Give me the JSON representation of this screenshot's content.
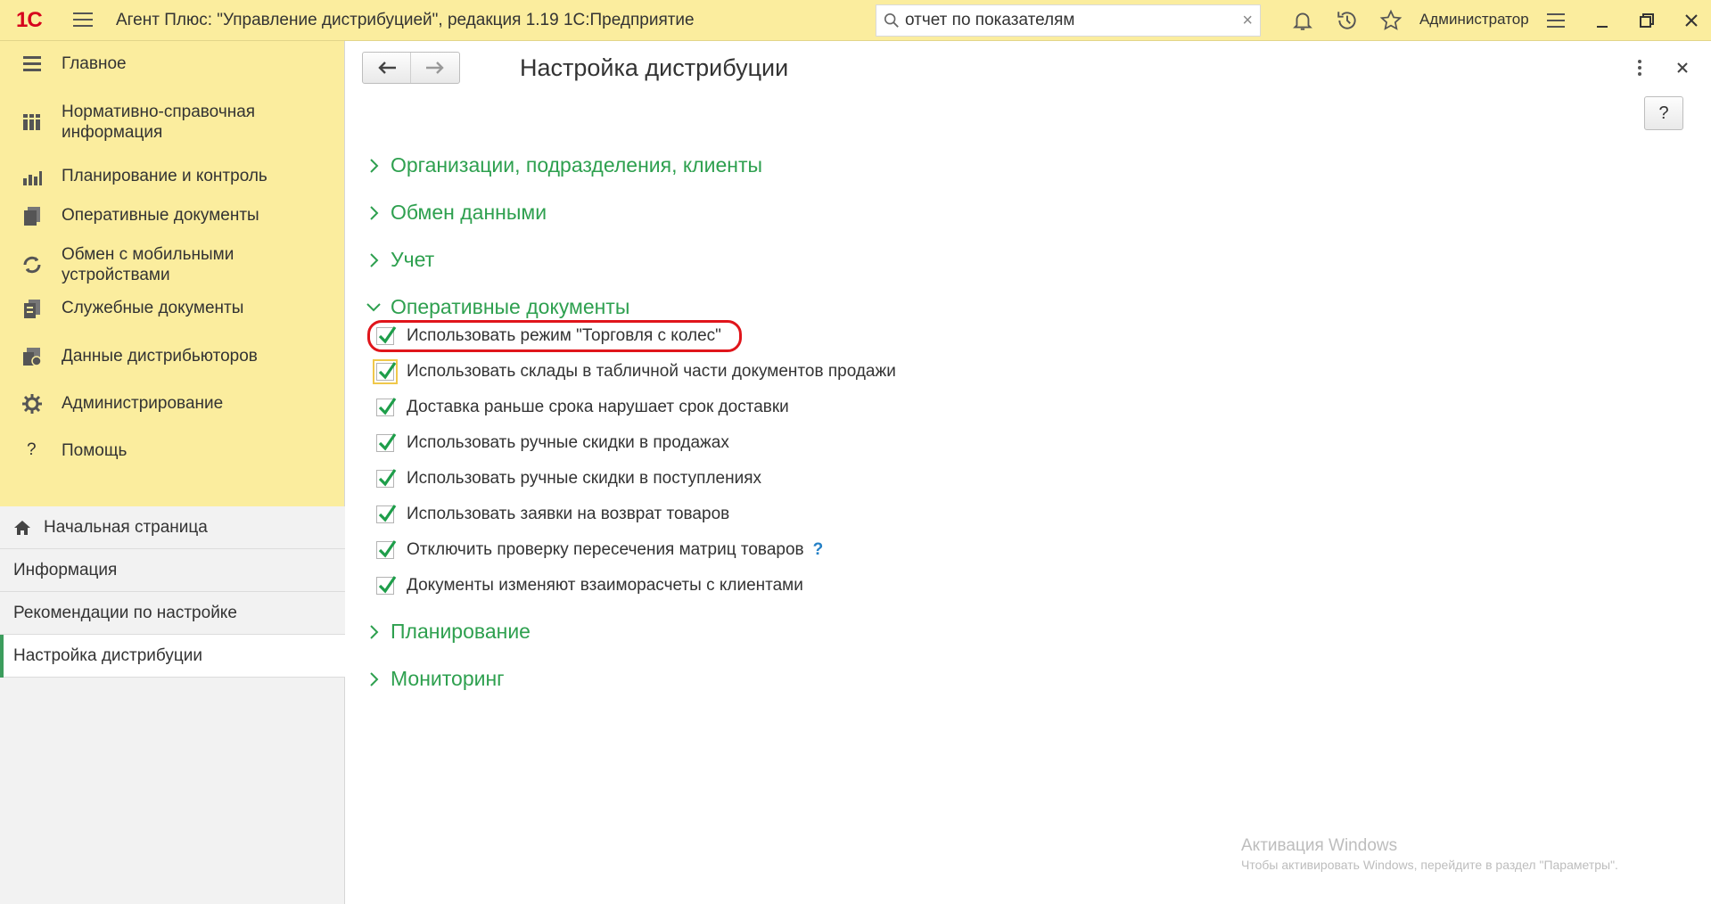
{
  "titlebar": {
    "logo": "1С",
    "app_title": "Агент Плюс: \"Управление дистрибуцией\", редакция 1.19 1С:Предприятие",
    "search": {
      "value": "отчет по показателям",
      "clear_glyph": "×"
    },
    "user": "Администратор"
  },
  "sidebar": {
    "sections": [
      {
        "label": "Главное",
        "icon": "menu-icon"
      },
      {
        "label": "Нормативно-справочная информация",
        "icon": "books-icon"
      },
      {
        "label": "Планирование и контроль",
        "icon": "chart-icon"
      },
      {
        "label": "Оперативные документы",
        "icon": "documents-icon"
      },
      {
        "label": "Обмен с мобильными устройствами",
        "icon": "sync-icon"
      },
      {
        "label": "Служебные документы",
        "icon": "service-docs-icon"
      },
      {
        "label": "Данные дистрибьюторов",
        "icon": "distributor-data-icon"
      },
      {
        "label": "Администрирование",
        "icon": "gear-icon"
      },
      {
        "label": "Помощь",
        "icon": "help-icon"
      }
    ],
    "open_windows": [
      {
        "label": "Начальная страница",
        "icon": "home-icon"
      },
      {
        "label": "Информация"
      },
      {
        "label": "Рекомендации по настройке"
      },
      {
        "label": "Настройка дистрибуции",
        "active": true
      }
    ]
  },
  "content": {
    "title": "Настройка дистрибуции",
    "help_label": "?",
    "groups": [
      {
        "label": "Организации, подразделения, клиенты",
        "expanded": false
      },
      {
        "label": "Обмен данными",
        "expanded": false
      },
      {
        "label": "Учет",
        "expanded": false
      },
      {
        "label": "Оперативные документы",
        "expanded": true
      },
      {
        "label": "Планирование",
        "expanded": false
      },
      {
        "label": "Мониторинг",
        "expanded": false
      }
    ],
    "checkboxes": [
      {
        "label": "Использовать режим \"Торговля с колес\"",
        "checked": true,
        "highlighted": true
      },
      {
        "label": "Использовать склады в табличной части документов продажи",
        "checked": true,
        "focused": true
      },
      {
        "label": "Доставка раньше срока нарушает срок доставки",
        "checked": true
      },
      {
        "label": "Использовать ручные скидки в продажах",
        "checked": true
      },
      {
        "label": "Использовать ручные скидки в поступлениях",
        "checked": true
      },
      {
        "label": "Использовать заявки на возврат товаров",
        "checked": true
      },
      {
        "label": "Отключить проверку пересечения матриц товаров",
        "checked": true,
        "help": "?"
      },
      {
        "label": "Документы изменяют взаиморасчеты с клиентами",
        "checked": true
      }
    ]
  },
  "watermark": {
    "line1": "Активация Windows",
    "line2": "Чтобы активировать Windows, перейдите в раздел \"Параметры\"."
  },
  "colors": {
    "titlebar_bg": "#fbed9e",
    "accent_green": "#2ea04f",
    "highlight_red": "#e0151b",
    "check_green": "#1e9e4a"
  }
}
